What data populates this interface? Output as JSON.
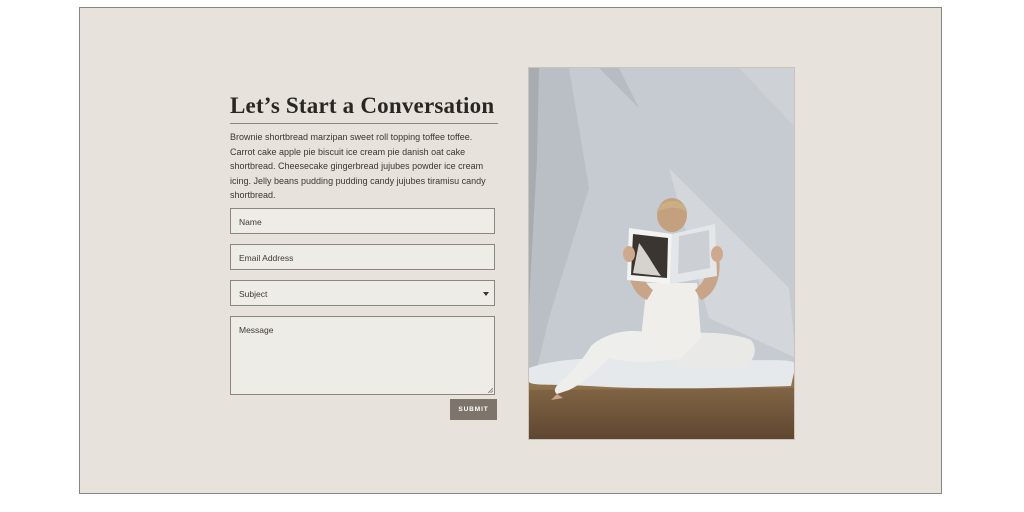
{
  "contact": {
    "title": "Let’s Start a Conversation",
    "intro": "Brownie shortbread marzipan sweet roll topping toffee toffee. Carrot cake apple pie biscuit ice cream pie danish oat cake shortbread. Cheesecake gingerbread jujubes powder ice cream icing. Jelly beans pudding pudding candy jujubes tiramisu candy shortbread.",
    "form": {
      "name_placeholder": "Name",
      "email_placeholder": "Email Address",
      "subject_selected": "Subject",
      "message_placeholder": "Message",
      "submit_label": "SUBMIT"
    }
  },
  "colors": {
    "background": "#e7e2dc",
    "field_bg": "#eeece7",
    "button": "#7d746c"
  },
  "photo": {
    "subject": "woman in white seated on a sheet in grass reading a magazine"
  }
}
